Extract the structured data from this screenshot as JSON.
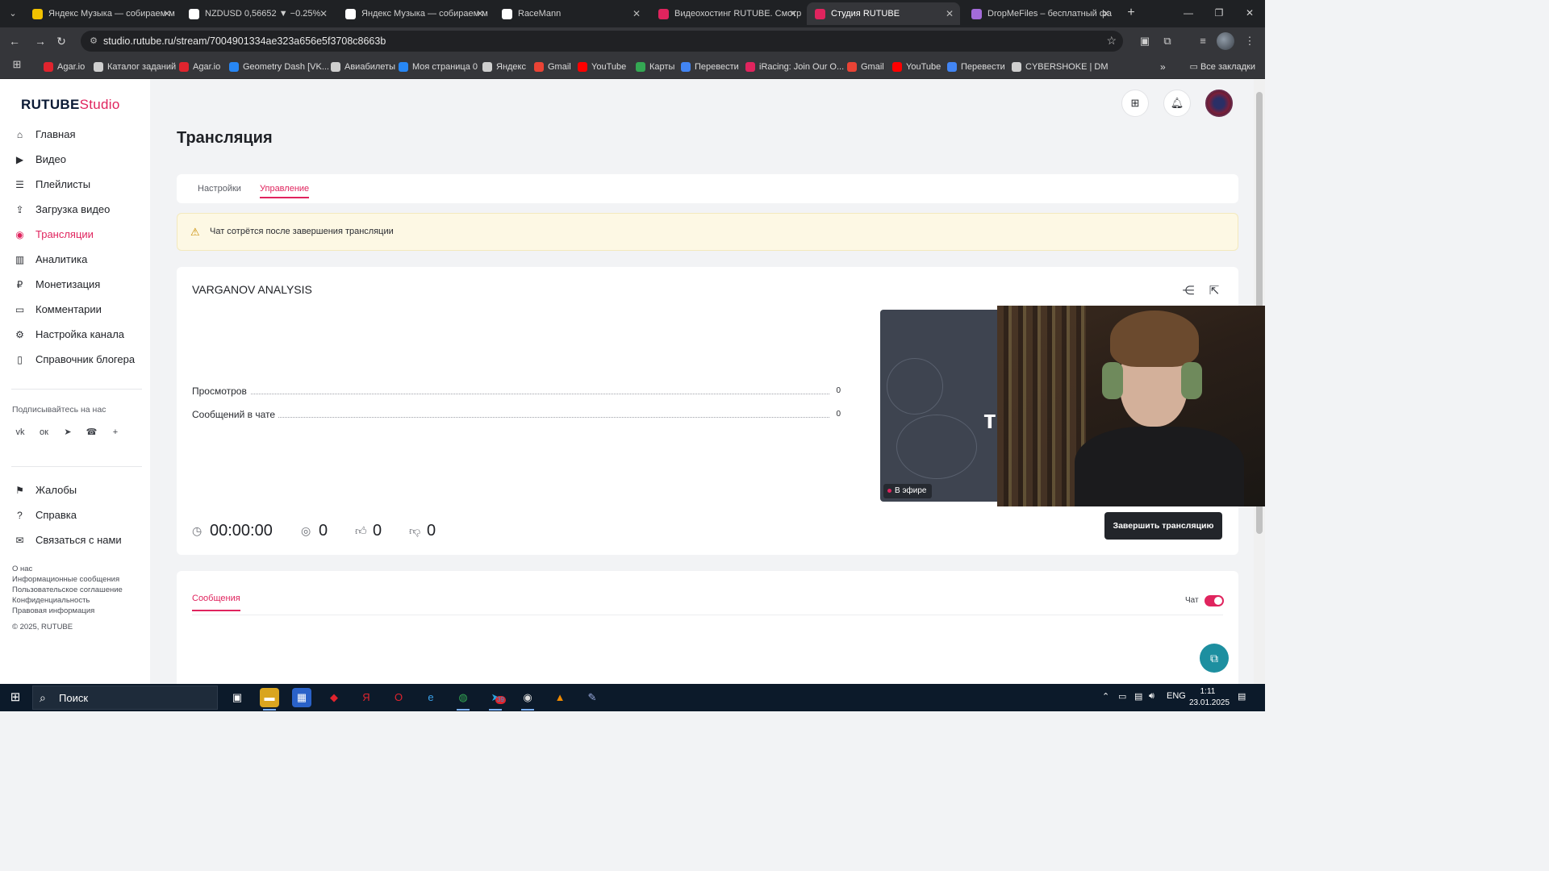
{
  "browser": {
    "tabs": [
      {
        "title": "Яндекс Музыка — собираем м",
        "icon_color": "#f2c200"
      },
      {
        "title": "NZDUSD 0,56652 ▼ −0.25%",
        "icon_color": "#ffffff"
      },
      {
        "title": "Яндекс Музыка — собираем м",
        "icon_color": "#ffffff"
      },
      {
        "title": "RaceMann",
        "icon_color": "#ffffff"
      },
      {
        "title": "Видеохостинг RUTUBE. Смотр",
        "icon_color": "#e0245e"
      },
      {
        "title": "Студия RUTUBE",
        "icon_color": "#e0245e"
      },
      {
        "title": "DropMeFiles – бесплатный фа",
        "icon_color": "#a36bd9"
      }
    ],
    "url": "studio.rutube.ru/stream/7004901334ae323a656e5f3708c8663b",
    "bookmarks": [
      {
        "label": "Agar.io",
        "color": "#e0242e"
      },
      {
        "label": "Каталог заданий",
        "color": "#cfcfcf"
      },
      {
        "label": "Agar.io",
        "color": "#e0242e"
      },
      {
        "label": "Geometry Dash [VK...",
        "color": "#2787f5"
      },
      {
        "label": "Авиабилеты",
        "color": "#cfcfcf"
      },
      {
        "label": "Моя страница 0",
        "color": "#2787f5"
      },
      {
        "label": "Яндекс",
        "color": "#cfcfcf"
      },
      {
        "label": "Gmail",
        "color": "#ea4335"
      },
      {
        "label": "YouTube",
        "color": "#ff0000"
      },
      {
        "label": "Карты",
        "color": "#34a853"
      },
      {
        "label": "Перевести",
        "color": "#4285f4"
      },
      {
        "label": "iRacing: Join Our O...",
        "color": "#e0245e"
      },
      {
        "label": "Gmail",
        "color": "#ea4335"
      },
      {
        "label": "YouTube",
        "color": "#ff0000"
      },
      {
        "label": "Перевести",
        "color": "#4285f4"
      },
      {
        "label": "CYBERSHOKE | DM",
        "color": "#cfcfcf"
      }
    ],
    "more": "»",
    "all_bookmarks": "Все закладки"
  },
  "sidebar": {
    "logo_main": "RUTUBE",
    "logo_sub": "Studio",
    "nav": [
      {
        "label": "Главная",
        "icon": "home-icon",
        "glyph": "⌂"
      },
      {
        "label": "Видео",
        "icon": "video-icon",
        "glyph": "▶"
      },
      {
        "label": "Плейлисты",
        "icon": "playlist-icon",
        "glyph": "☰"
      },
      {
        "label": "Загрузка видео",
        "icon": "upload-icon",
        "glyph": "⇪"
      },
      {
        "label": "Трансляции",
        "icon": "broadcast-icon",
        "glyph": "◉"
      },
      {
        "label": "Аналитика",
        "icon": "analytics-icon",
        "glyph": "▥"
      },
      {
        "label": "Монетизация",
        "icon": "money-icon",
        "glyph": "₽"
      },
      {
        "label": "Комментарии",
        "icon": "comment-icon",
        "glyph": "▭"
      },
      {
        "label": "Настройка канала",
        "icon": "gear-icon",
        "glyph": "⚙"
      },
      {
        "label": "Справочник блогера",
        "icon": "book-icon",
        "glyph": "▯"
      }
    ],
    "follow_us": "Подписывайтесь на нас",
    "social": [
      {
        "name": "vk-icon",
        "glyph": "vk"
      },
      {
        "name": "ok-icon",
        "glyph": "ок"
      },
      {
        "name": "telegram-icon",
        "glyph": "➤"
      },
      {
        "name": "viber-icon",
        "glyph": "☎"
      },
      {
        "name": "plus-icon",
        "glyph": "+"
      }
    ],
    "nav2": [
      {
        "label": "Жалобы",
        "icon": "flag-icon",
        "glyph": "⚑"
      },
      {
        "label": "Справка",
        "icon": "help-icon",
        "glyph": "?"
      },
      {
        "label": "Связаться с нами",
        "icon": "mail-icon",
        "glyph": "✉"
      }
    ],
    "footer": [
      "О нас",
      "Информационные сообщения",
      "Пользовательское соглашение",
      "Конфиденциальность",
      "Правовая информация",
      "© 2025, RUTUBE"
    ]
  },
  "main": {
    "title": "Трансляция",
    "tabs": [
      "Настройки",
      "Управление"
    ],
    "active_tab": "Управление",
    "notice": "Чат сотрётся после завершения трансляции",
    "stream": {
      "name": "VARGANOV ANALYSIS",
      "stats": [
        {
          "label": "Просмотров",
          "value": "0"
        },
        {
          "label": "Сообщений в чате",
          "value": "0"
        }
      ],
      "duration": "00:00:00",
      "viewers": "0",
      "likes": "0",
      "dislikes": "0",
      "preview_text": "тр",
      "live_badge": "В эфире",
      "end_button": "Завершить трансляцию"
    },
    "messages_tab": "Сообщения",
    "chat_label": "Чат",
    "chat_enabled": true
  },
  "taskbar": {
    "search_placeholder": "Поиск",
    "lang": "ENG",
    "time": "1:11",
    "date": "23.01.2025",
    "telegram_badge": "39"
  },
  "colors": {
    "accent": "#e0245e",
    "dark_button": "#22252a",
    "notice_bg": "#fdf8e4"
  }
}
